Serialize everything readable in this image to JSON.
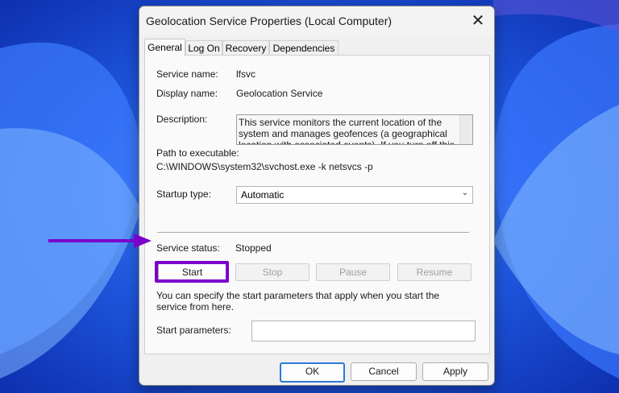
{
  "window": {
    "title": "Geolocation Service Properties (Local Computer)",
    "close_glyph": "✕"
  },
  "tabs": [
    "General",
    "Log On",
    "Recovery",
    "Dependencies"
  ],
  "general": {
    "service_name_label": "Service name:",
    "service_name_value": "lfsvc",
    "display_name_label": "Display name:",
    "display_name_value": "Geolocation Service",
    "description_label": "Description:",
    "description_value": "This service monitors the current location of the system and manages geofences (a geographical location with associated events). If you turn off this service",
    "path_label": "Path to executable:",
    "path_value": "C:\\WINDOWS\\system32\\svchost.exe -k netsvcs -p",
    "startup_type_label": "Startup type:",
    "startup_type_value": "Automatic",
    "service_status_label": "Service status:",
    "service_status_value": "Stopped",
    "start_label": "Start",
    "stop_label": "Stop",
    "pause_label": "Pause",
    "resume_label": "Resume",
    "hint_text": "You can specify the start parameters that apply when you start the service from here.",
    "start_params_label": "Start parameters:",
    "start_params_value": ""
  },
  "footer": {
    "ok_label": "OK",
    "cancel_label": "Cancel",
    "apply_label": "Apply"
  },
  "colors": {
    "highlight": "#7b00cc",
    "wallpaper": "#1e4fd8"
  },
  "icons": {
    "close": "close-icon",
    "dropdown": "chevron-down-icon",
    "annotation": "arrow-annotation"
  }
}
